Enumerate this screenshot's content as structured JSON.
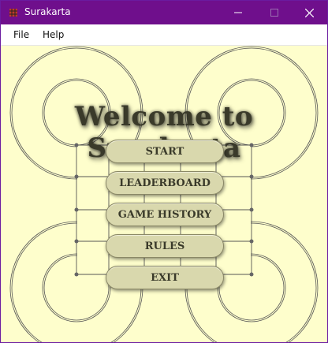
{
  "window": {
    "title": "Surakarta"
  },
  "menubar": {
    "items": [
      "File",
      "Help"
    ]
  },
  "main": {
    "heading": "Welcome to Surakarta",
    "buttons": [
      "START",
      "LEADERBOARD",
      "GAME HISTORY",
      "RULES",
      "EXIT"
    ]
  },
  "colors": {
    "titlebar": "#6f0f8c",
    "background": "#fefecc",
    "button": "#d9d8ad",
    "text": "#3a3a2a"
  },
  "icons": [
    "app-icon",
    "minimize-icon",
    "maximize-icon",
    "close-icon"
  ]
}
